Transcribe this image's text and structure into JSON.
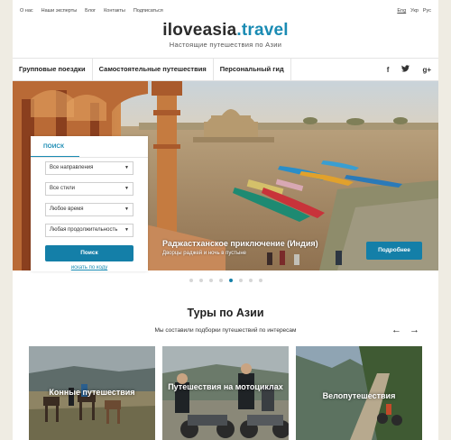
{
  "topbar": {
    "links": [
      "О нас",
      "Наши эксперты",
      "Блог",
      "Контакты",
      "Подписаться"
    ],
    "langs": [
      "Eng",
      "Укр",
      "Рус"
    ]
  },
  "logo": {
    "part1": "iloveasia",
    "part2": ".travel",
    "tagline": "Настоящие путешествия по Азии"
  },
  "nav": {
    "items": [
      "Групповые поездки",
      "Самостоятельные путешествия",
      "Персональный гид"
    ],
    "social": [
      "f",
      "t",
      "g+"
    ]
  },
  "search": {
    "tab": "ПОИСК",
    "selects": [
      "Все направления",
      "Все стили",
      "Любое время",
      "Любая продолжительность"
    ],
    "button": "Поиск",
    "link": "искать по коду"
  },
  "hero": {
    "title": "Раджастханское приключение (Индия)",
    "subtitle": "Дворцы раджей и ночь в пустыне",
    "button": "Подробнее",
    "slides": 8,
    "active_slide": 5
  },
  "tours": {
    "title": "Туры по Азии",
    "subtitle": "Мы составили подборки путешествий по интересам",
    "cards": [
      "Конные путешествия",
      "Путешествия на мотоциклах",
      "Велопутешествия"
    ]
  },
  "colors": {
    "accent": "#147fa8",
    "brand": "#1a8bb3"
  }
}
